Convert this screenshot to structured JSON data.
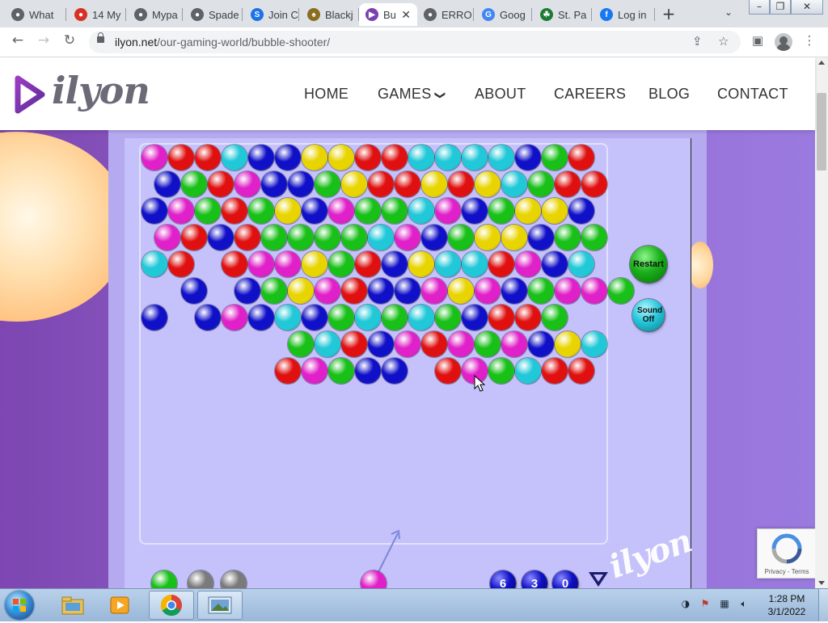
{
  "browser": {
    "tabs": [
      {
        "label": "What",
        "favicon": "chrome-icon",
        "color": "#5f6368",
        "glyph": "●"
      },
      {
        "label": "14 My",
        "favicon": "red-favicon-icon",
        "color": "#d93025",
        "glyph": "●"
      },
      {
        "label": "Mypa",
        "favicon": "chrome-icon",
        "color": "#5f6368",
        "glyph": "●"
      },
      {
        "label": "Spade",
        "favicon": "chrome-icon",
        "color": "#5f6368",
        "glyph": "●"
      },
      {
        "label": "Join C",
        "favicon": "s-favicon-icon",
        "color": "#1a73e8",
        "glyph": "S"
      },
      {
        "label": "Blackj",
        "favicon": "cards-favicon-icon",
        "color": "#8a6d1f",
        "glyph": "♠"
      },
      {
        "label": "Bu",
        "favicon": "ilyon-favicon-icon",
        "color": "#7b3fb0",
        "glyph": "▶",
        "active": true
      },
      {
        "label": "ERRO",
        "favicon": "chrome-icon",
        "color": "#5f6368",
        "glyph": "●"
      },
      {
        "label": "Goog",
        "favicon": "google-icon",
        "color": "#4285f4",
        "glyph": "G"
      },
      {
        "label": "St. Pa",
        "favicon": "stpatrick-favicon-icon",
        "color": "#1e7b34",
        "glyph": "☘"
      },
      {
        "label": "Log in",
        "favicon": "facebook-icon",
        "color": "#1877f2",
        "glyph": "f"
      }
    ],
    "new_tab_symbol": "+",
    "tab_close_symbol": "✕",
    "url_domain": "ilyon.net",
    "url_path": "/our-gaming-world/bubble-shooter/"
  },
  "site": {
    "logo_text": "ilyon",
    "nav": [
      "HOME",
      "GAMES",
      "ABOUT",
      "CAREERS",
      "BLOG",
      "CONTACT"
    ],
    "games_caret": "❯"
  },
  "game": {
    "colors": {
      "M": "#e020c8",
      "R": "#e01010",
      "C": "#20c8d8",
      "B": "#1010c8",
      "Y": "#e8d400",
      "G": "#18c018",
      "K": "#7a7a7a"
    },
    "grid_rows": [
      "MRRCBBYYRRCCCCBGR",
      "BGRMBBGYRRYRYCGRR",
      "BMGRGYBMGGCMBGYYB",
      "MRBRGGGGCMBGYYBGG",
      "CR.RMMYGRBYCCRMBC",
      ".B.BGYMRBBMYMBGMMG",
      "B.BMBCBGCGCGBRRG",
      ".....GCRBMRMGMBYC",
      ".....RMGBB.RMGCRR"
    ],
    "queue_bubbles": [
      "G",
      "K",
      "K"
    ],
    "shooter_bubble": "M",
    "score_digits": [
      "6",
      "3",
      "0"
    ],
    "restart_label": "Restart",
    "sound_label": "Sound Off",
    "watermark": "ilyon"
  },
  "recaptcha": {
    "links": "Privacy - Terms"
  },
  "taskbar": {
    "apps": [
      "windows-explorer-icon",
      "media-player-icon",
      "chrome-icon",
      "photo-viewer-icon"
    ],
    "time": "1:28 PM",
    "date": "3/1/2022"
  }
}
